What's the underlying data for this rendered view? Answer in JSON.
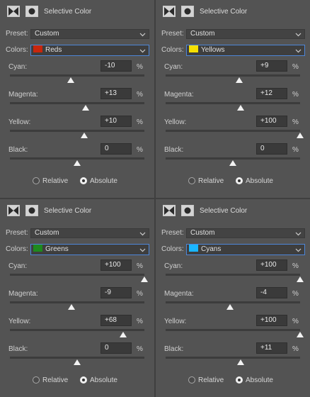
{
  "colors": {
    "accent_border": "#4d86d8",
    "bg": "#535353",
    "field_bg": "#3a3a3a"
  },
  "panels": [
    {
      "title": "Selective Color",
      "icons": [
        "adjustment-layer-icon",
        "layer-mask-icon"
      ],
      "preset_label": "Preset:",
      "preset_value": "Custom",
      "colors_label": "Colors:",
      "colors_value": "Reds",
      "swatch": "#c8260d",
      "sliders": [
        {
          "label": "Cyan:",
          "value": "-10",
          "unit": "%",
          "amount": -10
        },
        {
          "label": "Magenta:",
          "value": "+13",
          "unit": "%",
          "amount": 13
        },
        {
          "label": "Yellow:",
          "value": "+10",
          "unit": "%",
          "amount": 10
        },
        {
          "label": "Black:",
          "value": "0",
          "unit": "%",
          "amount": 0
        }
      ],
      "relative_label": "Relative",
      "absolute_label": "Absolute",
      "mode": "absolute"
    },
    {
      "title": "Selective Color",
      "icons": [
        "adjustment-layer-icon",
        "layer-mask-icon"
      ],
      "preset_label": "Preset:",
      "preset_value": "Custom",
      "colors_label": "Colors:",
      "colors_value": "Yellows",
      "swatch": "#f5e000",
      "sliders": [
        {
          "label": "Cyan:",
          "value": "+9",
          "unit": "%",
          "amount": 9
        },
        {
          "label": "Magenta:",
          "value": "+12",
          "unit": "%",
          "amount": 12
        },
        {
          "label": "Yellow:",
          "value": "+100",
          "unit": "%",
          "amount": 100
        },
        {
          "label": "Black:",
          "value": "0",
          "unit": "%",
          "amount": 0
        }
      ],
      "relative_label": "Relative",
      "absolute_label": "Absolute",
      "mode": "absolute"
    },
    {
      "title": "Selective Color",
      "icons": [
        "adjustment-layer-icon",
        "layer-mask-icon"
      ],
      "preset_label": "Preset:",
      "preset_value": "Custom",
      "colors_label": "Colors:",
      "colors_value": "Greens",
      "swatch": "#1e8a1e",
      "sliders": [
        {
          "label": "Cyan:",
          "value": "+100",
          "unit": "%",
          "amount": 100
        },
        {
          "label": "Magenta:",
          "value": "-9",
          "unit": "%",
          "amount": -9
        },
        {
          "label": "Yellow:",
          "value": "+68",
          "unit": "%",
          "amount": 68
        },
        {
          "label": "Black:",
          "value": "0",
          "unit": "%",
          "amount": 0
        }
      ],
      "relative_label": "Relative",
      "absolute_label": "Absolute",
      "mode": "absolute"
    },
    {
      "title": "Selective Color",
      "icons": [
        "adjustment-layer-icon",
        "layer-mask-icon"
      ],
      "preset_label": "Preset:",
      "preset_value": "Custom",
      "colors_label": "Colors:",
      "colors_value": "Cyans",
      "swatch": "#1ab6ff",
      "sliders": [
        {
          "label": "Cyan:",
          "value": "+100",
          "unit": "%",
          "amount": 100
        },
        {
          "label": "Magenta:",
          "value": "-4",
          "unit": "%",
          "amount": -4
        },
        {
          "label": "Yellow:",
          "value": "+100",
          "unit": "%",
          "amount": 100
        },
        {
          "label": "Black:",
          "value": "+11",
          "unit": "%",
          "amount": 11
        }
      ],
      "relative_label": "Relative",
      "absolute_label": "Absolute",
      "mode": "absolute"
    }
  ]
}
